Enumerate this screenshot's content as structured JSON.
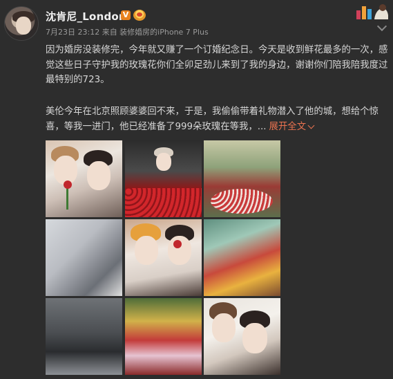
{
  "post": {
    "username": "沈肯尼_London",
    "verified_badge": "V",
    "meta": "7月23日 23:12 来自 装修婚房的iPhone 7 Plus",
    "paragraph1": "因为婚房没装修完，今年就又赚了一个订婚纪念日。今天是收到鲜花最多的一次，感觉这些日子守护我的玫瑰花你们全卯足劲儿来到了我的身边，谢谢你们陪我陪我度过最特别的723。",
    "paragraph2": "美伦今年在北京照顾婆婆回不来，于是，我偷偷带着礼物潜入了他的城，想给个惊喜，等我一进门，他已经准备了999朵玫瑰在等我，...",
    "expand_label": "展开全文",
    "accent_color": "#eb7350"
  },
  "icons": {
    "avatar": "avatar",
    "rank": "rank-badge-icon",
    "more": "chevron-down-icon"
  }
}
